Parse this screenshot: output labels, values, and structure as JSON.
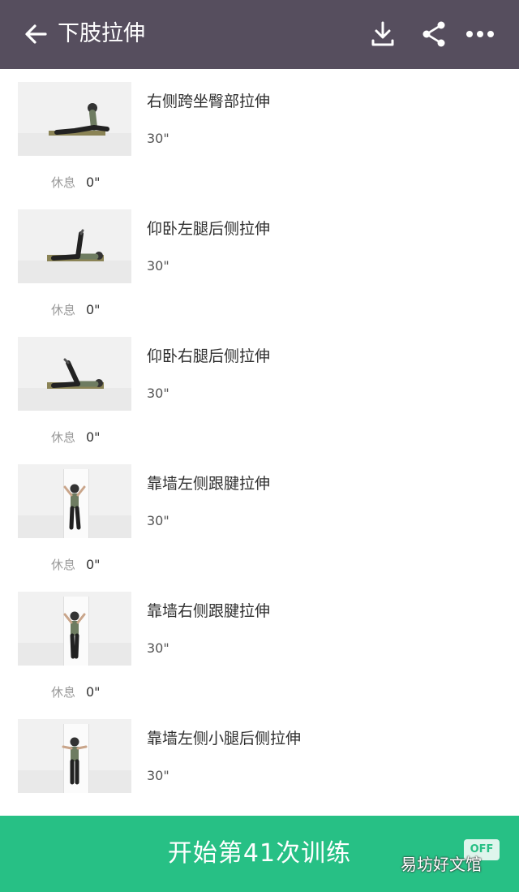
{
  "header": {
    "title": "下肢拉伸",
    "back_icon": "arrow-left-icon",
    "actions": [
      "download-icon",
      "share-icon",
      "more-icon"
    ]
  },
  "exercises": [
    {
      "name": "右侧跨坐臀部拉伸",
      "duration": "30\"",
      "rest_label": "休息",
      "rest": "0\"",
      "pose": "sitting-split"
    },
    {
      "name": "仰卧左腿后侧拉伸",
      "duration": "30\"",
      "rest_label": "休息",
      "rest": "0\"",
      "pose": "supine-leg-raise"
    },
    {
      "name": "仰卧右腿后侧拉伸",
      "duration": "30\"",
      "rest_label": "休息",
      "rest": "0\"",
      "pose": "supine-leg-raise"
    },
    {
      "name": "靠墙左侧跟腱拉伸",
      "duration": "30\"",
      "rest_label": "休息",
      "rest": "0\"",
      "pose": "wall-standing"
    },
    {
      "name": "靠墙右侧跟腱拉伸",
      "duration": "30\"",
      "rest_label": "休息",
      "rest": "0\"",
      "pose": "wall-standing"
    },
    {
      "name": "靠墙左侧小腿后侧拉伸",
      "duration": "30\"",
      "rest_label": "",
      "rest": "",
      "pose": "wall-standing"
    }
  ],
  "footer": {
    "start_label": "开始第41次训练",
    "badge": "OFF",
    "watermark": "易坊好文馆"
  },
  "colors": {
    "header_bg": "#564e5e",
    "accent": "#27c085"
  }
}
